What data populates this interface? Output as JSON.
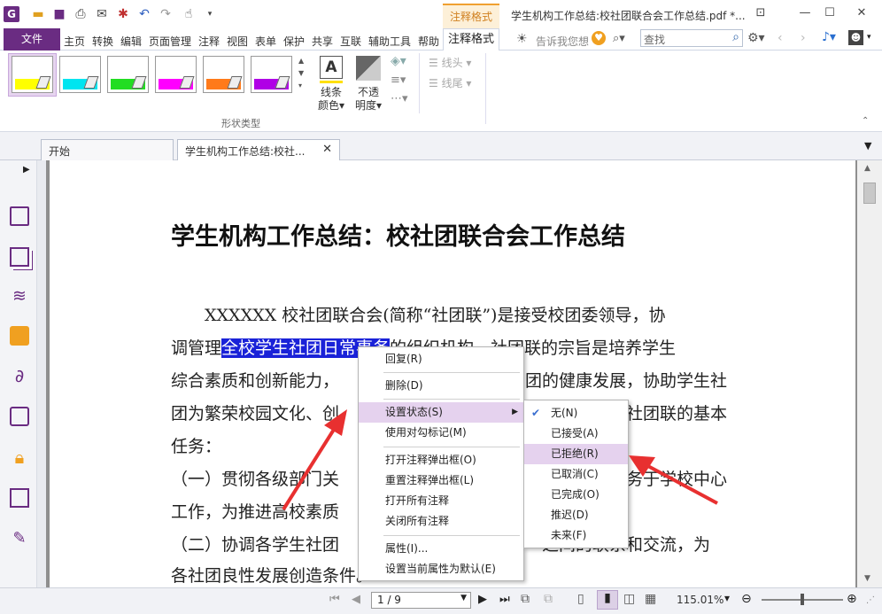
{
  "app": {
    "ctx_tab_top": "注释格式",
    "window_title": "学生机构工作总结:校社团联合会工作总结.pdf *...",
    "file_tab": "文件",
    "menu": [
      "主页",
      "转换",
      "编辑",
      "页面管理",
      "注释",
      "视图",
      "表单",
      "保护",
      "共享",
      "互联",
      "辅助工具",
      "帮助"
    ],
    "active_tab": "注释格式",
    "tell_me": "告诉我您想",
    "search_placeholder": "查找"
  },
  "ribbon": {
    "swatches": [
      {
        "color": "#ffff00"
      },
      {
        "color": "#00e5f0"
      },
      {
        "color": "#22dd22"
      },
      {
        "color": "#ff00ff"
      },
      {
        "color": "#ff7a1a"
      },
      {
        "color": "#b000e6"
      }
    ],
    "group_label": "形状类型",
    "line_color": [
      "线条",
      "颜色"
    ],
    "opacity": [
      "不透",
      "明度"
    ],
    "line_head": "线头",
    "line_tail": "线尾"
  },
  "tabs": [
    {
      "label": "开始"
    },
    {
      "label": "学生机构工作总结:校社..."
    }
  ],
  "document": {
    "title": "学生机构工作总结：校社团联合会工作总结",
    "lines": [
      "　　XXXXXX 校社团联合会(简称“社团联”)是接受校团委领导，协",
      "调管理",
      "的组织机构。社团联的宗旨是培养学生",
      "综合素质和创新能力，",
      "团的健康发展，协助学生社",
      "团为繁荣校园文化、创",
      "社团联的基本",
      "任务：",
      "（一）贯彻各级部门关",
      "务于学校中心",
      "工作，为推进高校素质",
      "（二）协调各学生社团",
      "之间的联系和交流，为",
      "各社团良性发展创造条件。"
    ],
    "highlight": "全校学生社团日常事务"
  },
  "context_menu": {
    "items": [
      "回复(R)",
      "删除(D)",
      "设置状态(S)",
      "使用对勾标记(M)",
      "打开注释弹出框(O)",
      "重置注释弹出框(L)",
      "打开所有注释",
      "关闭所有注释",
      "属性(I)...",
      "设置当前属性为默认(E)"
    ]
  },
  "submenu": {
    "items": [
      "无(N)",
      "已接受(A)",
      "已拒绝(R)",
      "已取消(C)",
      "已完成(O)",
      "推迟(D)",
      "未来(F)"
    ],
    "checked_index": 0,
    "hover_index": 2
  },
  "status": {
    "page": "1 / 9",
    "zoom": "115.01%"
  }
}
